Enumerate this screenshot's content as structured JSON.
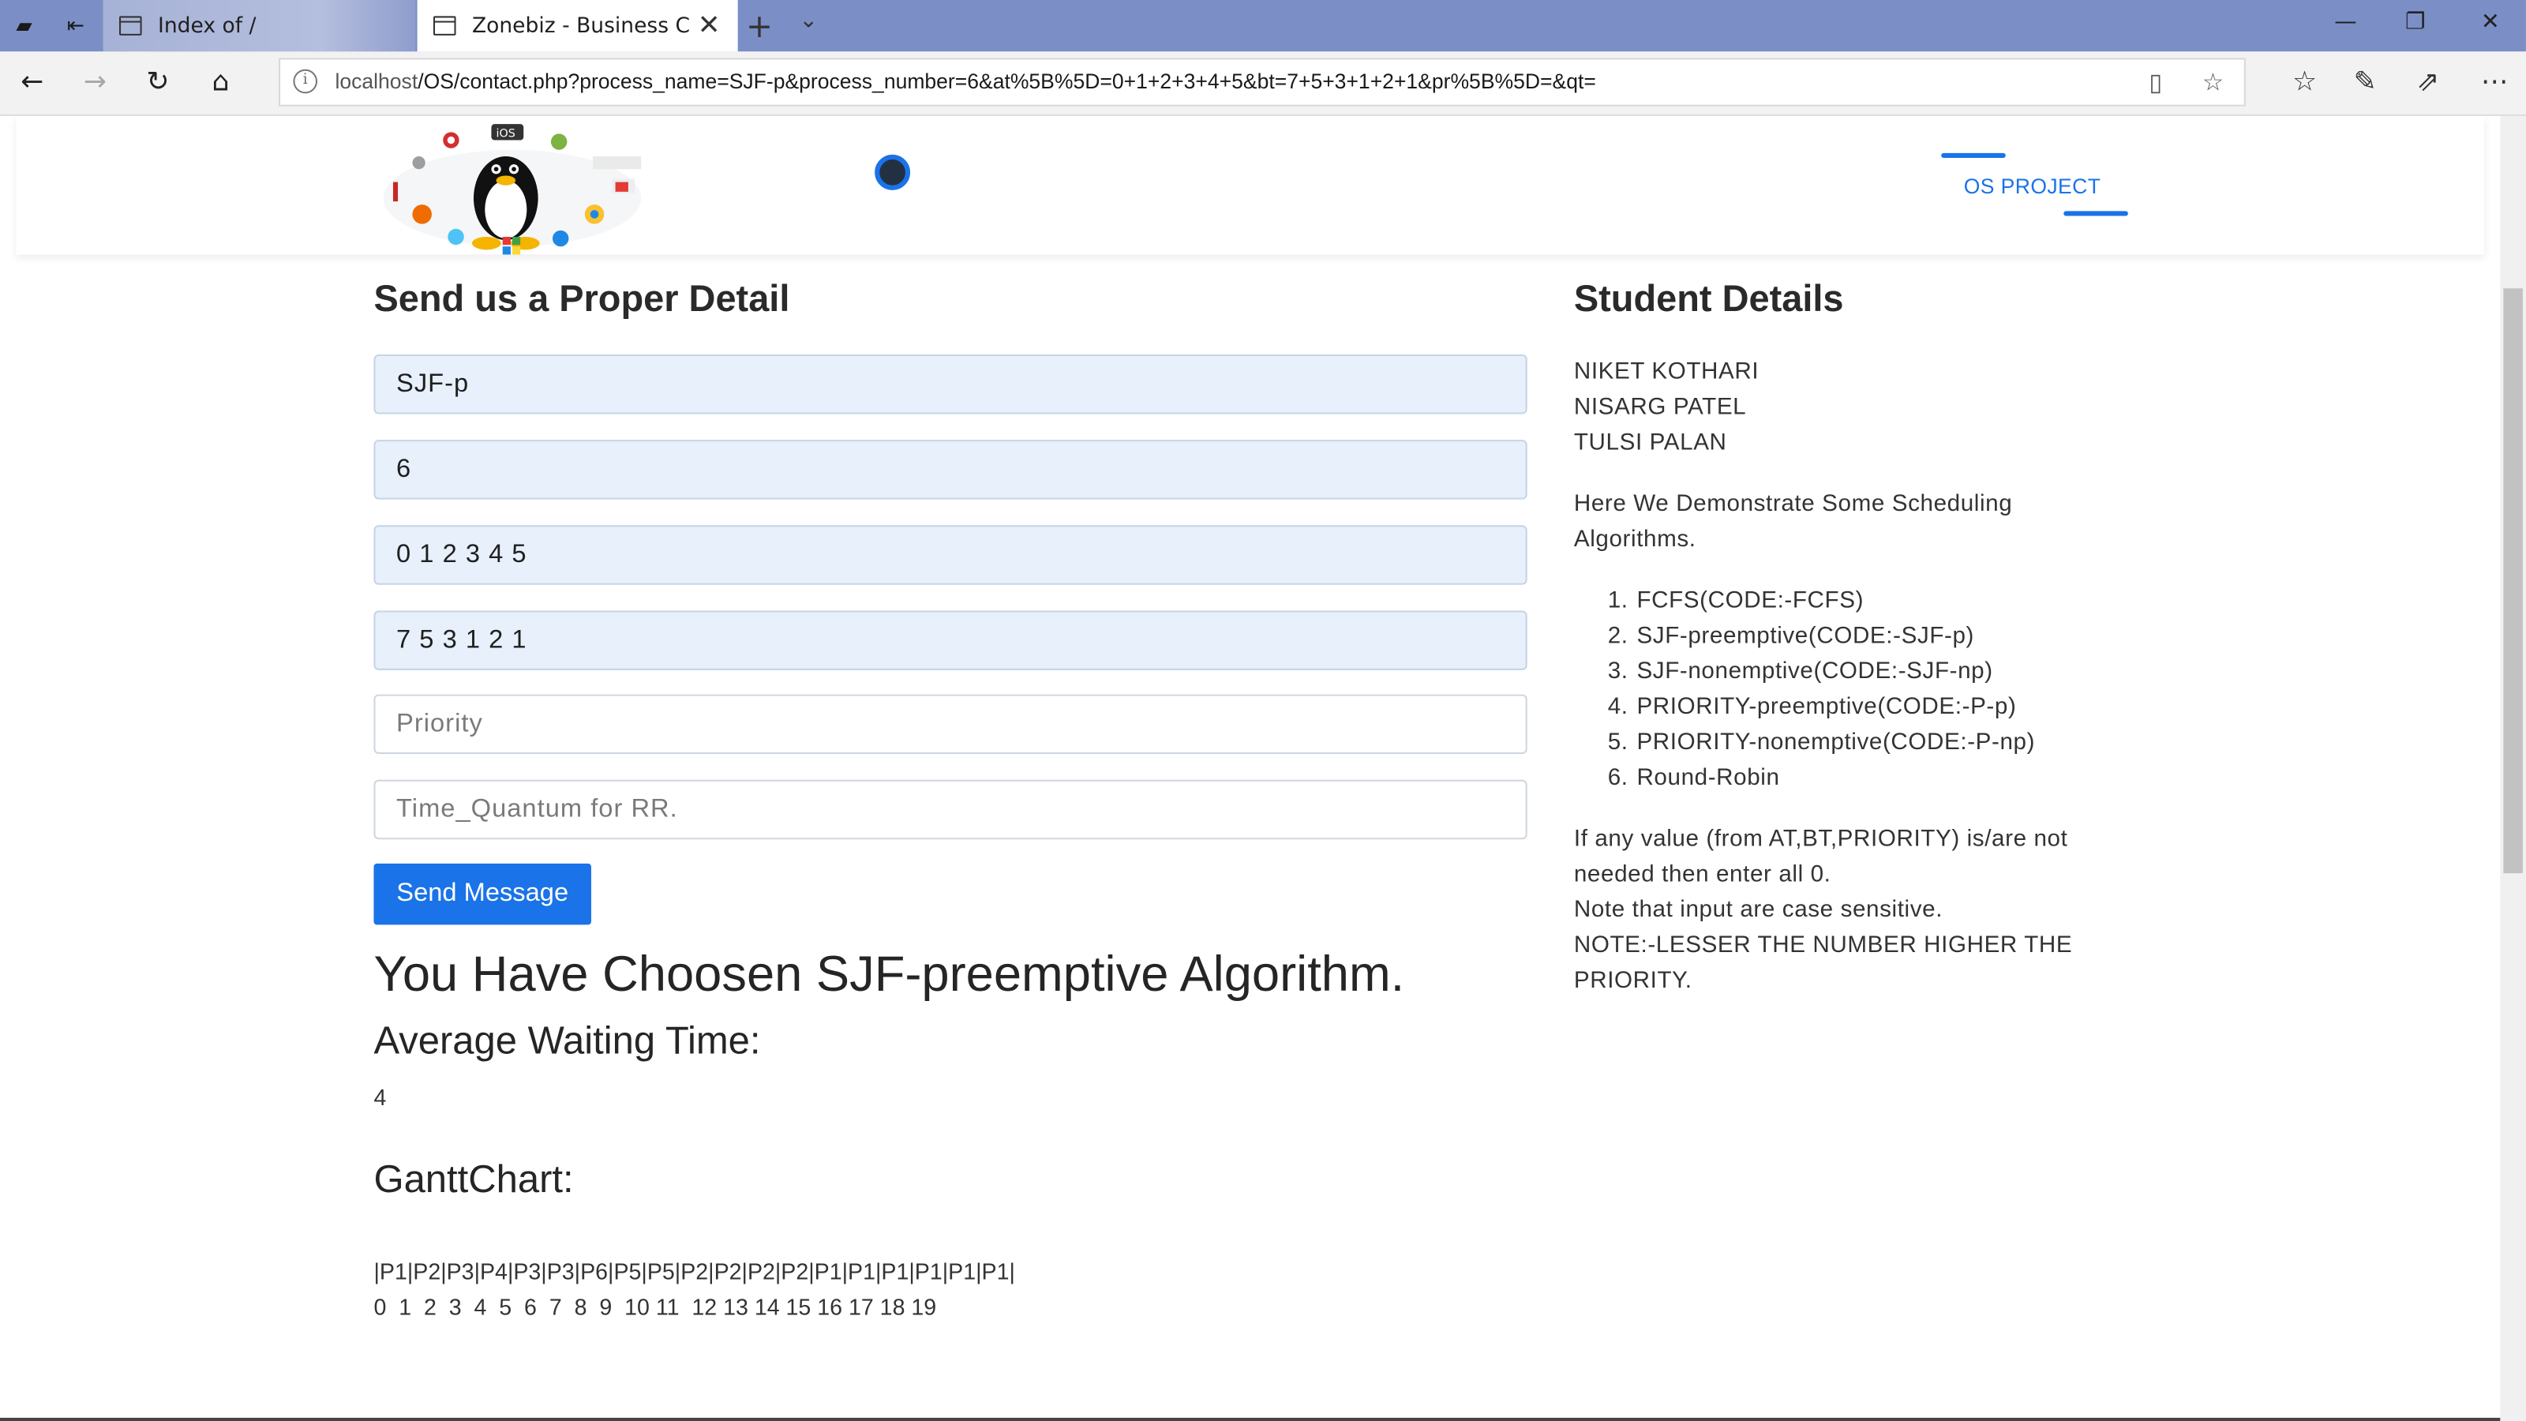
{
  "browser": {
    "tabs": [
      {
        "title": "Index of /"
      },
      {
        "title": "Zonebiz - Business Con:"
      }
    ],
    "address_domain": "localhost",
    "address_path": "/OS/contact.php?process_name=SJF-p&process_number=6&at%5B%5D=0+1+2+3+4+5&bt=7+5+3+1+2+1&pr%5B%5D=&qt="
  },
  "header": {
    "nav_label": "OS PROJECT"
  },
  "form": {
    "title": "Send us a Proper Detail",
    "fields": [
      {
        "value": "SJF-p"
      },
      {
        "value": "6"
      },
      {
        "value": "0 1 2 3 4 5"
      },
      {
        "value": "7 5 3 1 2 1"
      }
    ],
    "placeholders": {
      "priority": "Priority",
      "quantum": "Time_Quantum for RR."
    },
    "send_label": "Send Message"
  },
  "result": {
    "heading": "You Have Choosen SJF-preemptive Algorithm.",
    "avg_label": "Average Waiting Time:",
    "avg_value": "4",
    "gantt_label": "GanttChart:",
    "gantt_row": "|P1|P2|P3|P4|P3|P3|P6|P5|P5|P2|P2|P2|P2|P1|P1|P1|P1|P1|P1|",
    "gantt_times": "0  1  2  3  4  5  6  7  8  9  10 11  12 13 14 15 16 17 18 19"
  },
  "sidebar": {
    "title": "Student Details",
    "students": [
      "NIKET KOTHARI",
      "NISARG PATEL",
      "TULSI PALAN"
    ],
    "intro_1": "Here We Demonstrate Some Scheduling",
    "intro_2": "Algorithms.",
    "algorithms": [
      "FCFS(CODE:-FCFS)",
      "SJF-preemptive(CODE:-SJF-p)",
      "SJF-nonemptive(CODE:-SJF-np)",
      "PRIORITY-preemptive(CODE:-P-p)",
      "PRIORITY-nonemptive(CODE:-P-np)",
      "Round-Robin"
    ],
    "note_1": "If any value (from AT,BT,PRIORITY) is/are not",
    "note_2": "needed then enter all 0.",
    "note_3": "Note that input are case sensitive.",
    "note_4": "NOTE:-LESSER THE NUMBER HIGHER THE",
    "note_5": "PRIORITY."
  },
  "colors": {
    "accent": "#1a73e8",
    "tabbar": "#7b8fc6",
    "filled_input": "#e7f0fb"
  }
}
